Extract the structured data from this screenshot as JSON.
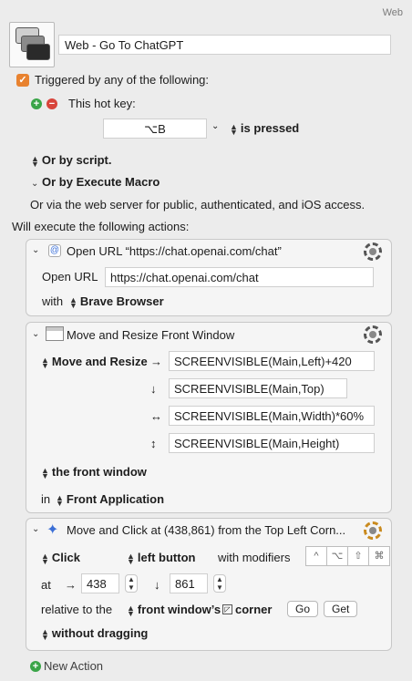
{
  "group": "Web",
  "macro": {
    "name": "Web - Go To ChatGPT"
  },
  "trigger": {
    "header": "Triggered by any of the following:",
    "hotkey_label": "This hot key:",
    "hotkey_value": "⌥B",
    "hotkey_state": "is pressed",
    "by_script": "Or by script.",
    "by_execute_macro": "Or by Execute Macro",
    "web_server": "Or via the web server for public, authenticated, and iOS access."
  },
  "will_execute": "Will execute the following actions:",
  "action1": {
    "title": "Open URL “https://chat.openai.com/chat”",
    "url_label": "Open URL",
    "url_value": "https://chat.openai.com/chat",
    "with_label": "with",
    "browser": "Brave Browser"
  },
  "action2": {
    "title": "Move and Resize Front Window",
    "mode": "Move and Resize",
    "left": "SCREENVISIBLE(Main,Left)+420",
    "top": "SCREENVISIBLE(Main,Top)",
    "width": "SCREENVISIBLE(Main,Width)*60%",
    "height": "SCREENVISIBLE(Main,Height)",
    "arrow_right": "→",
    "arrow_down": "↓",
    "arrow_lr": "↔",
    "arrow_ud": "↕",
    "target": "the front window",
    "in_label": "in",
    "app": "Front Application"
  },
  "action3": {
    "title": "Move and Click at (438,861) from the Top Left Corn...",
    "click_type": "Click",
    "button": "left button",
    "with_modifiers": "with modifiers",
    "modifiers": [
      "^",
      "⌥",
      "⇧",
      "⌘"
    ],
    "at_label": "at",
    "arrow_right": "→",
    "x": "438",
    "arrow_down": "↓",
    "y": "861",
    "relative_label": "relative to the",
    "relative_target": "front window’s",
    "corner_label": "corner",
    "go_button": "Go",
    "get_button": "Get",
    "drag_mode": "without dragging"
  },
  "new_action": "New Action",
  "colors": {
    "accent": "#e8822f",
    "plus": "#3aa548",
    "minus": "#d8443b"
  }
}
